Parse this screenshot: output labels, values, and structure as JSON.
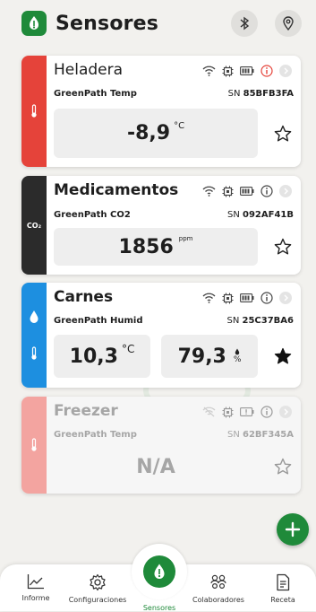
{
  "header": {
    "title": "Sensores",
    "brand_color": "#1f8a3a"
  },
  "sensors": [
    {
      "name": "Heladera",
      "model": "GreenPath Temp",
      "sn_prefix": "SN",
      "sn": "85BFB3FA",
      "value": "-8,9",
      "unit": "°C",
      "favorite": false,
      "stripe_color": "#e5433a",
      "type_icon": "thermometer-icon",
      "alert": true
    },
    {
      "name": "Medicamentos",
      "model": "GreenPath CO2",
      "sn_prefix": "SN",
      "sn": "092AF41B",
      "value": "1856",
      "unit": "ppm",
      "stripe_label": "CO₂",
      "favorite": false,
      "stripe_color": "#2b2b2b",
      "type_icon": "co2-icon"
    },
    {
      "name": "Carnes",
      "model": "GreenPath Humid",
      "sn_prefix": "SN",
      "sn": "25C37BA6",
      "value_temp": "10,3",
      "unit_temp": "°C",
      "value_humid": "79,3",
      "unit_humid": "%",
      "favorite": true,
      "stripe_color": "#1d8fe0",
      "type_icon": "droplet-icon"
    },
    {
      "name": "Freezer",
      "model": "GreenPath Temp",
      "sn_prefix": "SN",
      "sn": "62BF345A",
      "value": "N/A",
      "favorite": false,
      "stripe_color": "#f3a4a0",
      "disabled": true,
      "type_icon": "thermometer-icon"
    }
  ],
  "nav": [
    {
      "label": "Informe",
      "icon": "chart-line-icon"
    },
    {
      "label": "Configuraciones",
      "icon": "gear-icon"
    },
    {
      "label": "Sensores",
      "icon": "sensor-drop-icon",
      "active": true
    },
    {
      "label": "Colaboradores",
      "icon": "people-icon"
    },
    {
      "label": "Receta",
      "icon": "receipt-icon"
    }
  ]
}
